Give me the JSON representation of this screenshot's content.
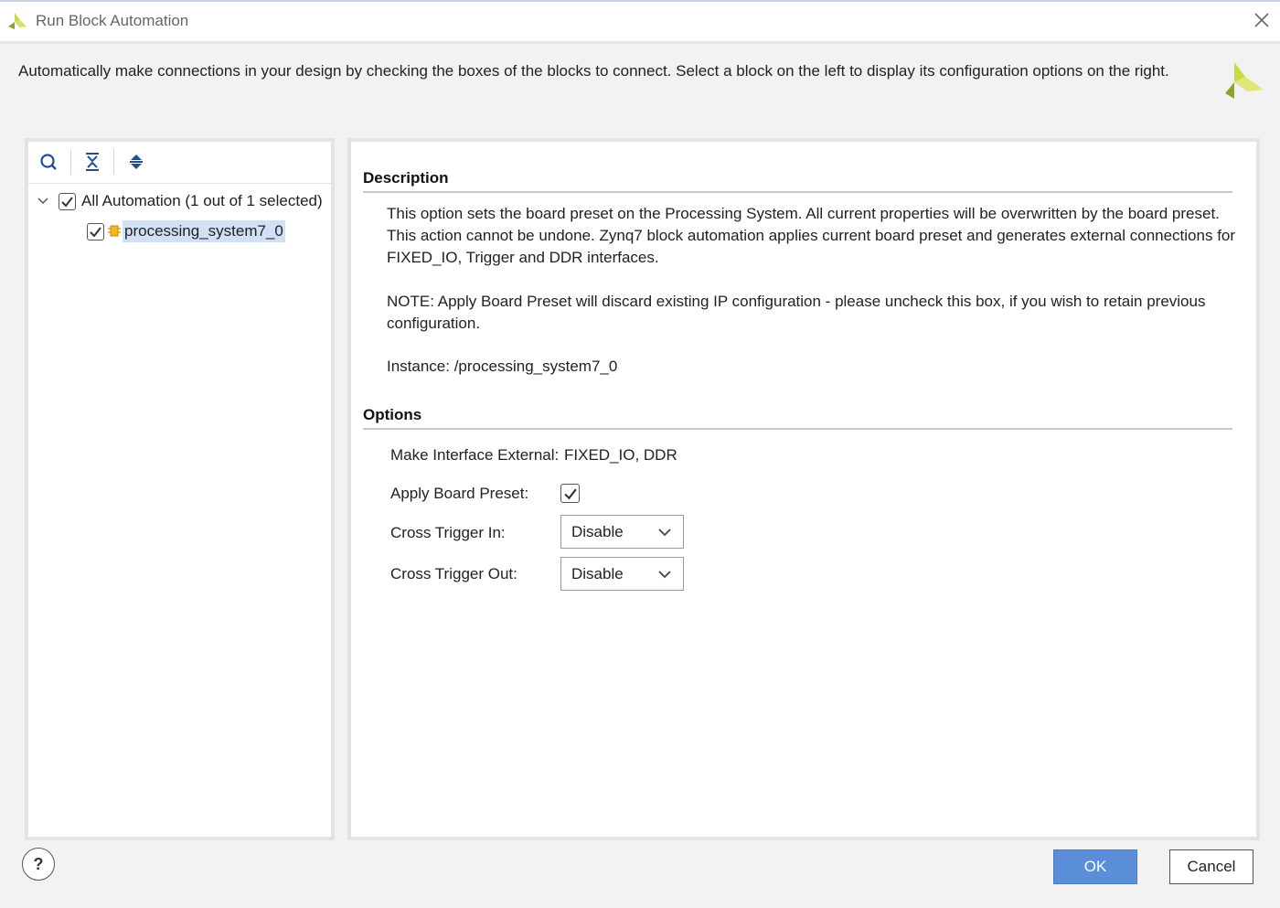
{
  "window": {
    "title": "Run Block Automation",
    "close_icon": "close-icon"
  },
  "instructions": "Automatically make connections in your design by checking the boxes of the blocks to connect. Select a block on the left to display its configuration options on the right.",
  "toolbar": {
    "icons": [
      "search-icon",
      "collapse-all-icon",
      "expand-all-icon"
    ]
  },
  "tree": {
    "root": {
      "label": "All Automation (1 out of 1 selected)",
      "checked": true,
      "expanded": true
    },
    "child": {
      "label": "processing_system7_0",
      "checked": true,
      "icon": "ip-block-icon"
    }
  },
  "description": {
    "heading": "Description",
    "para1": "This option sets the board preset on the Processing System. All current properties will be overwritten by the board preset. This action cannot be undone. Zynq7 block automation applies current board preset and generates external connections for FIXED_IO, Trigger and DDR interfaces.",
    "para2": "NOTE: Apply Board Preset will discard existing IP configuration - please uncheck this box, if you wish to retain previous configuration.",
    "para3": "Instance: /processing_system7_0"
  },
  "options": {
    "heading": "Options",
    "make_interface_label": "Make Interface External:",
    "make_interface_value": "FIXED_IO, DDR",
    "apply_preset_label": "Apply Board Preset:",
    "apply_preset_checked": true,
    "cross_trigger_in_label": "Cross Trigger In:",
    "cross_trigger_in_value": "Disable",
    "cross_trigger_out_label": "Cross Trigger Out:",
    "cross_trigger_out_value": "Disable"
  },
  "footer": {
    "help_label": "?",
    "ok_label": "OK",
    "cancel_label": "Cancel"
  },
  "colors": {
    "accent": "#5b8ed8",
    "selection": "#cfe0f7",
    "logo_green": "#a8c23a"
  }
}
